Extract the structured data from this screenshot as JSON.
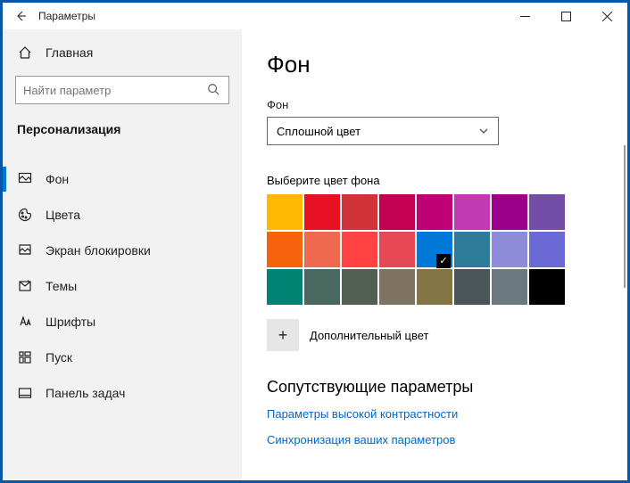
{
  "titlebar": {
    "title": "Параметры"
  },
  "sidebar": {
    "home_label": "Главная",
    "search_placeholder": "Найти параметр",
    "category_label": "Персонализация",
    "items": [
      {
        "label": "Фон"
      },
      {
        "label": "Цвета"
      },
      {
        "label": "Экран блокировки"
      },
      {
        "label": "Темы"
      },
      {
        "label": "Шрифты"
      },
      {
        "label": "Пуск"
      },
      {
        "label": "Панель задач"
      }
    ],
    "active_index": 0
  },
  "content": {
    "page_title": "Фон",
    "bg_type_label": "Фон",
    "bg_type_value": "Сплошной цвет",
    "colors_label": "Выберите цвет фона",
    "colors": [
      "#FFB900",
      "#E81123",
      "#D13438",
      "#C30052",
      "#BF0077",
      "#C239B3",
      "#9A0089",
      "#744DA9",
      "#F7630C",
      "#EF6950",
      "#FF4343",
      "#E74856",
      "#0078D7",
      "#2D7D9A",
      "#8E8CD8",
      "#6B69D6",
      "#008272",
      "#486860",
      "#525E54",
      "#7E735F",
      "#847545",
      "#4A5459",
      "#69797E",
      "#000000"
    ],
    "selected_color_index": 12,
    "custom_color_label": "Дополнительный цвет",
    "related_title": "Сопутствующие параметры",
    "link_contrast": "Параметры высокой контрастности",
    "link_sync": "Синхронизация ваших параметров"
  }
}
